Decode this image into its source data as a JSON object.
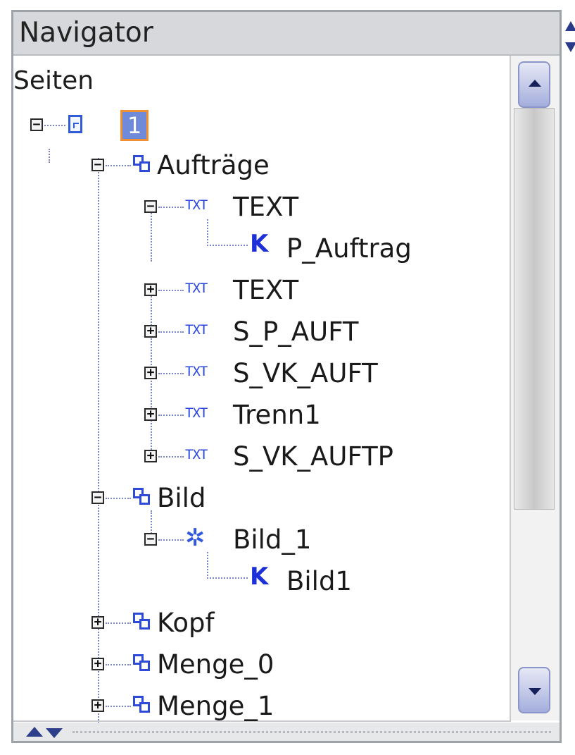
{
  "panel": {
    "title": "Navigator"
  },
  "tree": {
    "root_label": "Seiten",
    "page_label": "1",
    "nodes": [
      {
        "label": "Aufträge",
        "icon": "group-icon"
      },
      {
        "label": "TEXT",
        "icon": "text-field-icon"
      },
      {
        "label": "P_Auftrag",
        "icon": "key-icon"
      },
      {
        "label": "TEXT",
        "icon": "text-field-icon"
      },
      {
        "label": "S_P_AUFT",
        "icon": "text-field-icon"
      },
      {
        "label": "S_VK_AUFT",
        "icon": "text-field-icon"
      },
      {
        "label": "Trenn1",
        "icon": "text-field-icon"
      },
      {
        "label": "S_VK_AUFTP",
        "icon": "text-field-icon"
      },
      {
        "label": "Bild",
        "icon": "group-icon"
      },
      {
        "label": "Bild_1",
        "icon": "image-icon"
      },
      {
        "label": "Bild1",
        "icon": "key-icon"
      },
      {
        "label": "Kopf",
        "icon": "group-icon"
      },
      {
        "label": "Menge_0",
        "icon": "group-icon"
      },
      {
        "label": "Menge_1",
        "icon": "group-icon"
      }
    ]
  },
  "colors": {
    "accent": "#2d4bd8",
    "selection_fill": "#6f8ad8",
    "selection_border": "#f09030"
  }
}
